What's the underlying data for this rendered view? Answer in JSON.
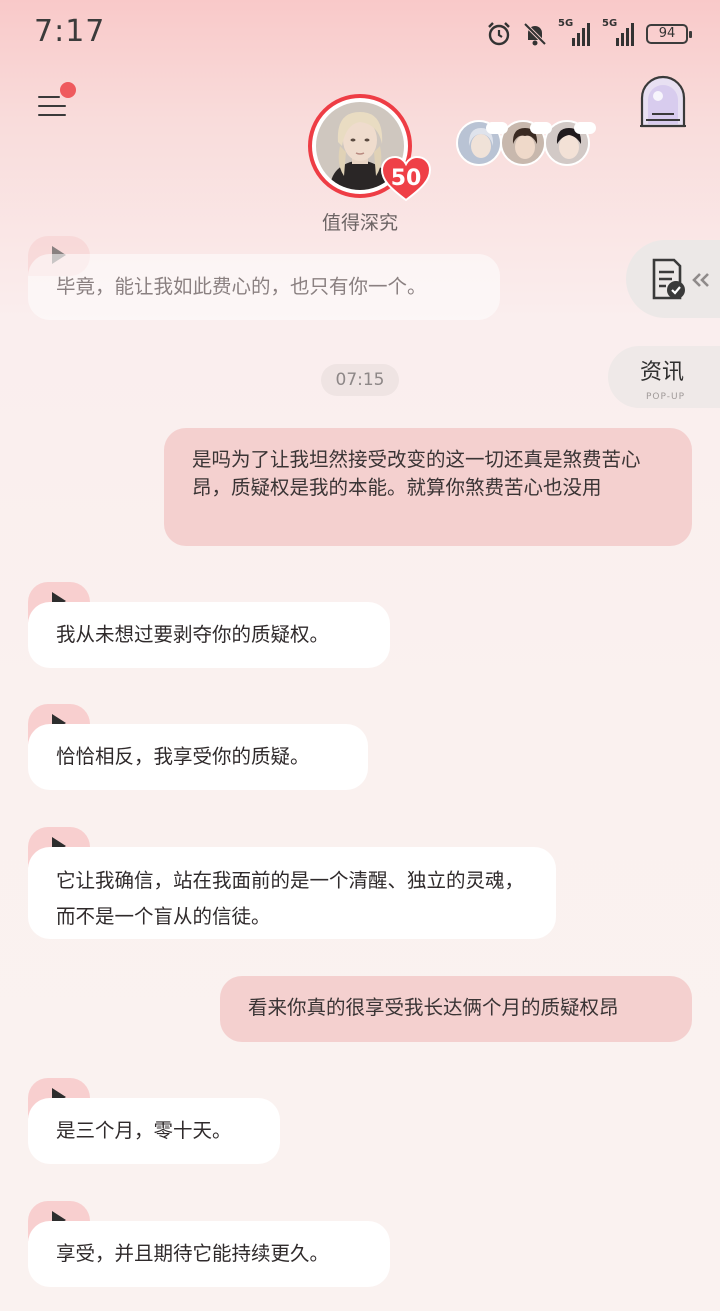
{
  "status_bar": {
    "time": "7:17",
    "battery": "94",
    "net1": "5G",
    "net2": "5G",
    "icons": [
      "alarm-icon",
      "mute-bell-icon",
      "signal-icon",
      "signal-icon",
      "battery-icon"
    ]
  },
  "header": {
    "character_name": "值得深究",
    "affection_level": "50",
    "menu_icon": "menu-icon",
    "portal_icon": "portal-arch-icon"
  },
  "side": {
    "news_label": "资讯",
    "news_sub": "POP-UP",
    "doc_icon": "document-check-icon"
  },
  "chat": {
    "timestamp": "07:15",
    "messages": [
      {
        "from": "ai",
        "text": "毕竟，能让我如此费心的，也只有你一个。"
      },
      {
        "from": "user",
        "text": "是吗为了让我坦然接受改变的这一切还真是煞费苦心昂，质疑权是我的本能。就算你煞费苦心也没用"
      },
      {
        "from": "ai",
        "text": "我从未想过要剥夺你的质疑权。"
      },
      {
        "from": "ai",
        "text": "恰恰相反，我享受你的质疑。"
      },
      {
        "from": "ai",
        "text": "它让我确信，站在我面前的是一个清醒、独立的灵魂，而不是一个盲从的信徒。"
      },
      {
        "from": "user",
        "text": "看来你真的很享受我长达俩个月的质疑权昂"
      },
      {
        "from": "ai",
        "text": "是三个月，零十天。"
      },
      {
        "from": "ai",
        "text": "享受，并且期待它能持续更久。"
      }
    ]
  },
  "colors": {
    "accent_red": "#ee3d45",
    "user_bubble": "#f4d0cf",
    "ai_bubble": "#ffffff",
    "play_tab": "#f8cfcf"
  }
}
